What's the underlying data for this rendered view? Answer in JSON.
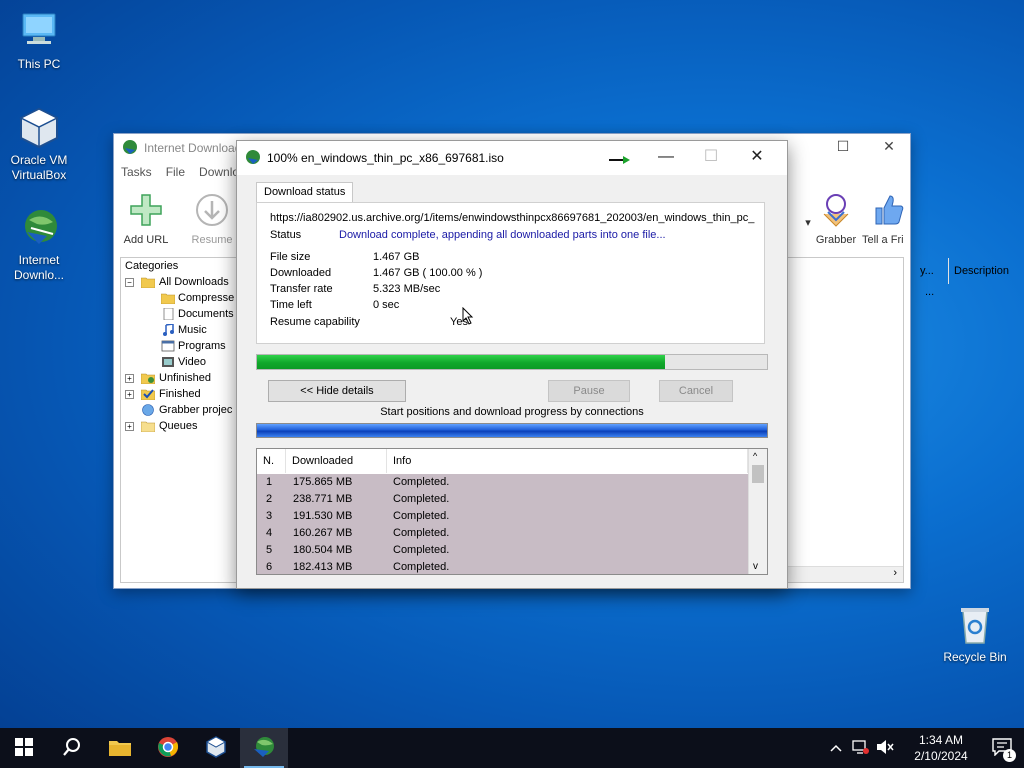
{
  "desktop": {
    "icons": [
      {
        "label": "This PC"
      },
      {
        "label": "Oracle VM VirtualBox"
      },
      {
        "label": "Internet Downlo..."
      },
      {
        "label": "Recycle Bin"
      }
    ]
  },
  "main_window": {
    "title": "Internet Download",
    "menu": [
      "Tasks",
      "File",
      "Downloa"
    ],
    "toolbar": {
      "add_url": "Add URL",
      "resume": "Resume",
      "grabber": "Grabber",
      "tell_friend": "Tell a Fri"
    },
    "categories": {
      "header": "Categories",
      "items": [
        {
          "label": "All Downloads"
        },
        {
          "label": "Compresse"
        },
        {
          "label": "Documents"
        },
        {
          "label": "Music"
        },
        {
          "label": "Programs"
        },
        {
          "label": "Video"
        },
        {
          "label": "Unfinished"
        },
        {
          "label": "Finished"
        },
        {
          "label": "Grabber projec"
        },
        {
          "label": "Queues"
        }
      ]
    },
    "list": {
      "col_partial": "y...",
      "col_description": "Description",
      "row_partial": "..."
    }
  },
  "dialog": {
    "title": "100% en_windows_thin_pc_x86_697681.iso",
    "tab": "Download status",
    "url": "https://ia802902.us.archive.org/1/items/enwindowsthinpcx86697681_202003/en_windows_thin_pc_",
    "status_label": "Status",
    "status_value": "Download complete, appending all downloaded parts into one file...",
    "file_size_label": "File size",
    "file_size_value": "1.467  GB",
    "downloaded_label": "Downloaded",
    "downloaded_value": "1.467  GB  ( 100.00 % )",
    "transfer_rate_label": "Transfer rate",
    "transfer_rate_value": "5.323  MB/sec",
    "time_left_label": "Time left",
    "time_left_value": "0 sec",
    "resume_label": "Resume capability",
    "resume_value": "Yes",
    "progress_fraction": 0.8,
    "hide_details": "<< Hide details",
    "pause": "Pause",
    "cancel": "Cancel",
    "connections_label": "Start positions and download progress by connections",
    "table": {
      "headers": [
        "N.",
        "Downloaded",
        "Info"
      ],
      "rows": [
        {
          "n": "1",
          "downloaded": "175.865  MB",
          "info": "Completed."
        },
        {
          "n": "2",
          "downloaded": "238.771  MB",
          "info": "Completed."
        },
        {
          "n": "3",
          "downloaded": "191.530  MB",
          "info": "Completed."
        },
        {
          "n": "4",
          "downloaded": "160.267  MB",
          "info": "Completed."
        },
        {
          "n": "5",
          "downloaded": "180.504  MB",
          "info": "Completed."
        },
        {
          "n": "6",
          "downloaded": "182.413  MB",
          "info": "Completed."
        }
      ]
    }
  },
  "taskbar": {
    "time": "1:34 AM",
    "date": "2/10/2024",
    "notification_count": "1"
  },
  "colors": {
    "progress_green": "#11a82b",
    "link_blue": "#1a1aa6",
    "selection_rows": "#c8bcc5",
    "taskbar": "#0c0f1a"
  }
}
